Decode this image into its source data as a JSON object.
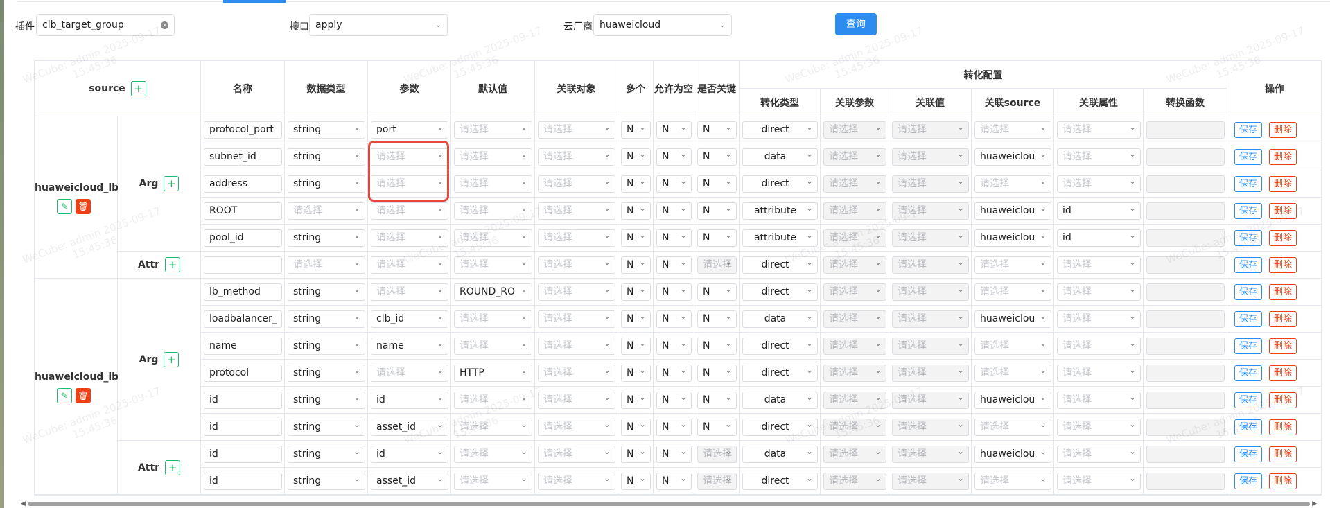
{
  "filters": {
    "plugin_label": "插件",
    "plugin_value": "clb_target_group",
    "interface_label": "接口",
    "interface_value": "apply",
    "vendor_label": "云厂商",
    "vendor_value": "huaweicloud",
    "query_button": "查询"
  },
  "watermark": {
    "line1": "WeCube: admin 2025-09-17",
    "line2": "15:45:36"
  },
  "headers": {
    "source": "source",
    "name": "名称",
    "datatype": "数据类型",
    "param": "参数",
    "default": "默认值",
    "relobj": "关联对象",
    "multi": "多个",
    "nullable": "允许为空",
    "iskey": "是否关键",
    "convert_group": "转化配置",
    "convert_type": "转化类型",
    "rel_param": "关联参数",
    "rel_value": "关联值",
    "rel_source": "关联source",
    "rel_attr": "关联属性",
    "conv_func": "转换函数",
    "ops": "操作"
  },
  "groups": [
    {
      "name": "huaweicloud_lb...",
      "arg_label": "Arg",
      "attr_label": "Attr"
    },
    {
      "name": "huaweicloud_lb...",
      "arg_label": "Arg",
      "attr_label": "Attr"
    }
  ],
  "placeholder": "请选择",
  "save_label": "保存",
  "delete_label": "删除",
  "rows": [
    {
      "name": "protocol_port",
      "dtype": "string",
      "param": "port",
      "def": "",
      "multi": "N",
      "nullable": "N",
      "key": "N",
      "ctype": "direct",
      "rsrc": "",
      "rattr": ""
    },
    {
      "name": "subnet_id",
      "dtype": "string",
      "param": "",
      "def": "",
      "multi": "N",
      "nullable": "N",
      "key": "N",
      "ctype": "data",
      "rsrc": "huaweiclou",
      "rattr": ""
    },
    {
      "name": "address",
      "dtype": "string",
      "param": "",
      "def": "",
      "multi": "N",
      "nullable": "N",
      "key": "N",
      "ctype": "direct",
      "rsrc": "",
      "rattr": ""
    },
    {
      "name": "ROOT",
      "dtype": "",
      "param": "",
      "def": "",
      "multi": "N",
      "nullable": "N",
      "key": "N",
      "ctype": "attribute",
      "rsrc": "huaweiclou",
      "rattr": "id"
    },
    {
      "name": "pool_id",
      "dtype": "string",
      "param": "",
      "def": "",
      "multi": "N",
      "nullable": "N",
      "key": "N",
      "ctype": "attribute",
      "rsrc": "huaweiclou",
      "rattr": "id"
    },
    {
      "name": "",
      "dtype": "",
      "param": "",
      "def": "",
      "multi": "N",
      "nullable": "N",
      "key": "请",
      "ctype": "direct",
      "rsrc": "",
      "rattr": ""
    },
    {
      "name": "lb_method",
      "dtype": "string",
      "param": "",
      "def": "ROUND_RO",
      "multi": "N",
      "nullable": "N",
      "key": "N",
      "ctype": "direct",
      "rsrc": "",
      "rattr": ""
    },
    {
      "name": "loadbalancer_",
      "dtype": "string",
      "param": "clb_id",
      "def": "",
      "multi": "N",
      "nullable": "N",
      "key": "N",
      "ctype": "data",
      "rsrc": "huaweiclou",
      "rattr": ""
    },
    {
      "name": "name",
      "dtype": "string",
      "param": "name",
      "def": "",
      "multi": "N",
      "nullable": "N",
      "key": "N",
      "ctype": "direct",
      "rsrc": "",
      "rattr": ""
    },
    {
      "name": "protocol",
      "dtype": "string",
      "param": "",
      "def": "HTTP",
      "multi": "N",
      "nullable": "N",
      "key": "N",
      "ctype": "direct",
      "rsrc": "",
      "rattr": ""
    },
    {
      "name": "id",
      "dtype": "string",
      "param": "id",
      "def": "",
      "multi": "N",
      "nullable": "N",
      "key": "N",
      "ctype": "data",
      "rsrc": "huaweiclou",
      "rattr": ""
    },
    {
      "name": "id",
      "dtype": "string",
      "param": "asset_id",
      "def": "",
      "multi": "N",
      "nullable": "N",
      "key": "N",
      "ctype": "direct",
      "rsrc": "",
      "rattr": ""
    },
    {
      "name": "id",
      "dtype": "string",
      "param": "id",
      "def": "",
      "multi": "N",
      "nullable": "N",
      "key": "请",
      "ctype": "data",
      "rsrc": "huaweiclou",
      "rattr": ""
    },
    {
      "name": "id",
      "dtype": "string",
      "param": "asset_id",
      "def": "",
      "multi": "N",
      "nullable": "N",
      "key": "请",
      "ctype": "direct",
      "rsrc": "",
      "rattr": ""
    }
  ]
}
